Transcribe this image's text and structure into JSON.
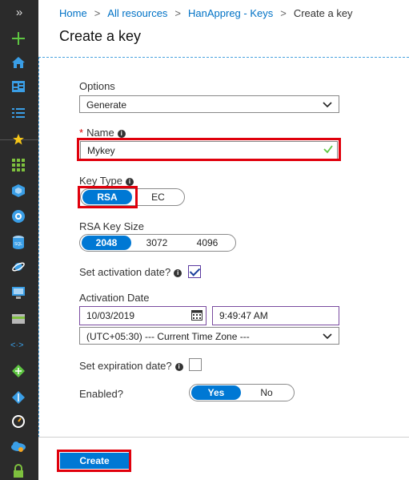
{
  "breadcrumb": [
    "Home",
    "All resources",
    "HanAppreg - Keys",
    "Create a key"
  ],
  "breadcrumb_sep": ">",
  "page_title": "Create a key",
  "nav": {
    "expand_icon": "»"
  },
  "options": {
    "label": "Options",
    "value": "Generate"
  },
  "name": {
    "required_mark": "*",
    "label": "Name",
    "value": "Mykey"
  },
  "key_type": {
    "label": "Key Type",
    "options": [
      "RSA",
      "EC"
    ],
    "selected": "RSA"
  },
  "rsa_key_size": {
    "label": "RSA Key Size",
    "options": [
      "2048",
      "3072",
      "4096"
    ],
    "selected": "2048"
  },
  "set_activation": {
    "label": "Set activation date?",
    "checked": true
  },
  "activation_date": {
    "label": "Activation Date",
    "date": "10/03/2019",
    "time": "9:49:47 AM",
    "timezone": "(UTC+05:30) --- Current Time Zone ---"
  },
  "set_expiration": {
    "label": "Set expiration date?",
    "checked": false
  },
  "enabled": {
    "label": "Enabled?",
    "options": [
      "Yes",
      "No"
    ],
    "selected": "Yes"
  },
  "create_button": "Create",
  "info_glyph": "i",
  "colors": {
    "accent": "#0078d4",
    "highlight": "#e0000c",
    "nav_bg": "#2b2b2b",
    "link": "#0072c6"
  }
}
